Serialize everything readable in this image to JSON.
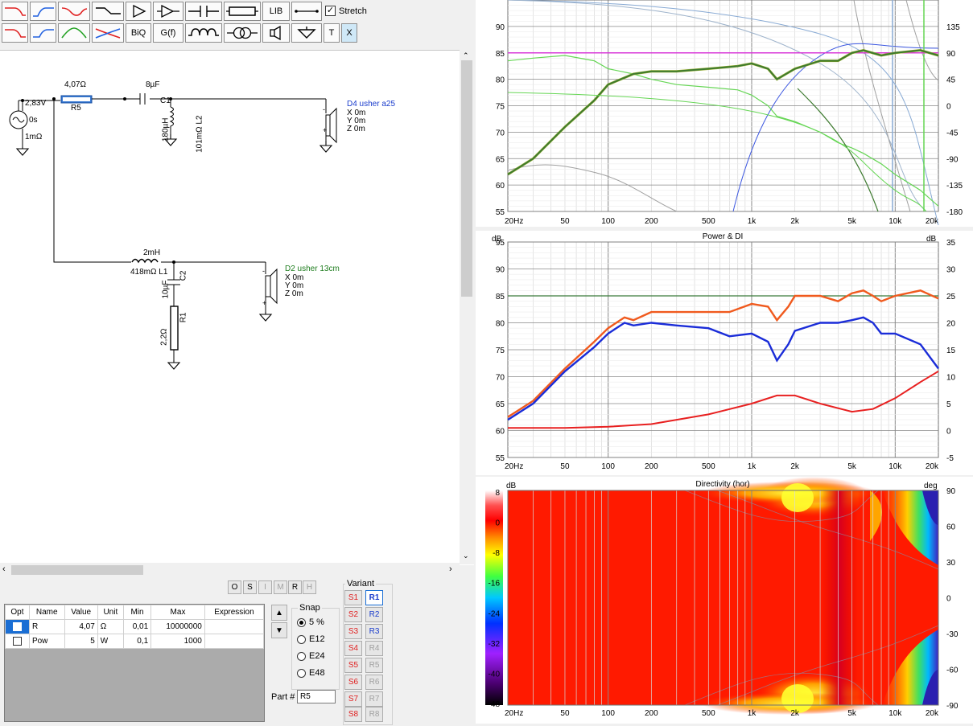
{
  "toolbar": {
    "lib_label": "LIB",
    "stretch_label": "Stretch",
    "biq_label": "BiQ",
    "gf_label": "G(f)",
    "t_label": "T",
    "x_label": "X"
  },
  "schematic": {
    "source_voltage": "2,83V",
    "source_time": "0s",
    "source_res": "1mΩ",
    "r5_value": "4,07Ω",
    "r5_name": "R5",
    "c1_value": "8µF",
    "c1_name": "C1",
    "l2_value": "180µH",
    "l2_res": "101mΩ L2",
    "d4_name": "D4 usher a25",
    "d4_x": "X 0m",
    "d4_y": "Y 0m",
    "d4_z": "Z 0m",
    "l1_value": "2mH",
    "l1_res": "418mΩ L1",
    "c2_value": "10µF",
    "c2_name": "C2",
    "r1_value": "2,2Ω",
    "r1_name": "R1",
    "d2_name": "D2 usher 13cm",
    "d2_x": "X 0m",
    "d2_y": "Y 0m",
    "d2_z": "Z 0m"
  },
  "bottom": {
    "small_buttons": [
      "O",
      "S",
      "I",
      "M",
      "R",
      "H"
    ],
    "table_headers": [
      "Opt",
      "Name",
      "Value",
      "Unit",
      "Min",
      "Max",
      "Expression"
    ],
    "rows": [
      {
        "name": "R",
        "value": "4,07",
        "unit": "Ω",
        "min": "0,01",
        "max": "10000000",
        "expr": ""
      },
      {
        "name": "Pow",
        "value": "5",
        "unit": "W",
        "min": "0,1",
        "max": "1000",
        "expr": ""
      }
    ],
    "snap_title": "Snap",
    "snap_options": [
      "5 %",
      "E12",
      "E24",
      "E48"
    ],
    "part_label": "Part #",
    "part_value": "R5",
    "variant_title": "Variant",
    "variant_s": [
      "S1",
      "S2",
      "S3",
      "S4",
      "S5",
      "S6",
      "S7",
      "S8"
    ],
    "variant_r": [
      "R1",
      "R2",
      "R3",
      "R4",
      "R5",
      "R6",
      "R7",
      "R8"
    ]
  },
  "colors": {
    "spl_dark": "#3d7a2f",
    "spl_light": "#66d655",
    "olive": "#9fb22f",
    "purple": "#5b2ca0",
    "magenta": "#d838d8",
    "blue": "#3c57e0",
    "steel": "#88aad4",
    "power_orange": "#f05a1e",
    "di_blue": "#1a2cd8",
    "di_red": "#e82020",
    "ref_green": "#3a7a3a"
  },
  "chart_data": [
    {
      "type": "line",
      "title": "",
      "xlim": [
        20,
        20000
      ],
      "x_scale": "log",
      "ylim": [
        55,
        95
      ],
      "y2lim": [
        -180,
        180
      ],
      "x_ticks": [
        "20Hz",
        "50",
        "100",
        "200",
        "500",
        "1k",
        "2k",
        "5k",
        "10k",
        "20k"
      ],
      "y_ticks": [
        "55",
        "60",
        "65",
        "70",
        "75",
        "80",
        "85",
        "90"
      ],
      "y2_ticks": [
        "-180",
        "-135",
        "-90",
        "-45",
        "0",
        "45",
        "90",
        "135"
      ],
      "series": [
        {
          "x": [
            20,
            30,
            50,
            80,
            100,
            150,
            200,
            300,
            500,
            800,
            1000,
            1300,
            1500,
            2000,
            3000,
            4000,
            5000,
            6000,
            8000,
            10000,
            15000,
            20000
          ],
          "values": [
            62,
            65,
            71,
            76,
            79,
            81,
            81.5,
            81.5,
            82,
            82.5,
            83,
            82,
            80,
            82,
            83.5,
            83.5,
            85,
            85.5,
            84.5,
            85,
            85.5,
            84.5
          ]
        },
        {
          "x": [
            20,
            30,
            50,
            80,
            100,
            150,
            200,
            300,
            500,
            800,
            1000,
            1300,
            1500,
            2000,
            3000,
            4000,
            5000,
            6000,
            8000,
            10000,
            15000,
            20000
          ],
          "values": [
            83.5,
            84,
            84.5,
            83.5,
            82,
            81,
            80,
            79,
            78.5,
            78,
            77,
            75,
            73,
            72,
            70,
            68,
            67,
            66,
            64,
            62,
            59,
            56
          ]
        },
        {
          "x": [
            20,
            50,
            100,
            200,
            500,
            1000,
            2000,
            5000,
            10000,
            20000
          ],
          "values": [
            85,
            85,
            85,
            85,
            85,
            85,
            85,
            85,
            85,
            85
          ]
        }
      ]
    },
    {
      "type": "line",
      "title": "Power & DI",
      "xlabel": "",
      "ylabel": "dB",
      "y2label": "dB",
      "xlim": [
        20,
        20000
      ],
      "x_scale": "log",
      "ylim": [
        55,
        95
      ],
      "y2lim": [
        -5,
        35
      ],
      "x_ticks": [
        "20Hz",
        "50",
        "100",
        "200",
        "500",
        "1k",
        "2k",
        "5k",
        "10k",
        "20k"
      ],
      "y_ticks": [
        "55",
        "60",
        "65",
        "70",
        "75",
        "80",
        "85",
        "90",
        "95"
      ],
      "y2_ticks": [
        "-5",
        "0",
        "5",
        "10",
        "15",
        "20",
        "25",
        "30",
        "35"
      ],
      "series": [
        {
          "x": [
            20,
            30,
            50,
            80,
            100,
            130,
            150,
            200,
            300,
            500,
            700,
            1000,
            1300,
            1500,
            1800,
            2000,
            3000,
            4000,
            5000,
            6000,
            7000,
            8000,
            10000,
            15000,
            20000
          ],
          "values": [
            62.5,
            65.5,
            71.5,
            76.5,
            79,
            81,
            80.5,
            82,
            82,
            82,
            82,
            83.5,
            83,
            80.5,
            83,
            85,
            85,
            84,
            85.5,
            86,
            85,
            84,
            85,
            86,
            84.5
          ]
        },
        {
          "x": [
            20,
            30,
            50,
            80,
            100,
            130,
            150,
            200,
            300,
            500,
            700,
            1000,
            1300,
            1500,
            1800,
            2000,
            3000,
            4000,
            5000,
            6000,
            7000,
            8000,
            10000,
            15000,
            20000
          ],
          "values": [
            62,
            65,
            71,
            75.5,
            78,
            80,
            79.5,
            80,
            79.5,
            79,
            77.5,
            78,
            76.5,
            73,
            76,
            78.5,
            80,
            80,
            80.5,
            81,
            80,
            78,
            78,
            76,
            71.5
          ]
        },
        {
          "x": [
            20,
            50,
            100,
            200,
            500,
            1000,
            1500,
            2000,
            3000,
            5000,
            7000,
            10000,
            15000,
            20000
          ],
          "values": [
            0.5,
            0.5,
            0.7,
            1.2,
            3,
            5,
            6.5,
            6.5,
            5,
            3.5,
            4,
            6,
            9,
            11
          ]
        },
        {
          "x": [
            20,
            20000
          ],
          "values": [
            85,
            85
          ]
        }
      ]
    },
    {
      "type": "heatmap",
      "title": "Directivity (hor)",
      "ylabel": "dB",
      "y2label": "deg",
      "xlim": [
        20,
        20000
      ],
      "x_scale": "log",
      "x_ticks": [
        "20Hz",
        "50",
        "100",
        "200",
        "500",
        "1k",
        "2k",
        "5k",
        "10k",
        "20k"
      ],
      "y2_ticks": [
        "90",
        "60",
        "30",
        "0",
        "-30",
        "-60",
        "-90"
      ],
      "colorbar_ticks": [
        "8",
        "0",
        "-8",
        "-16",
        "-24",
        "-32",
        "-40",
        "-48"
      ]
    }
  ]
}
